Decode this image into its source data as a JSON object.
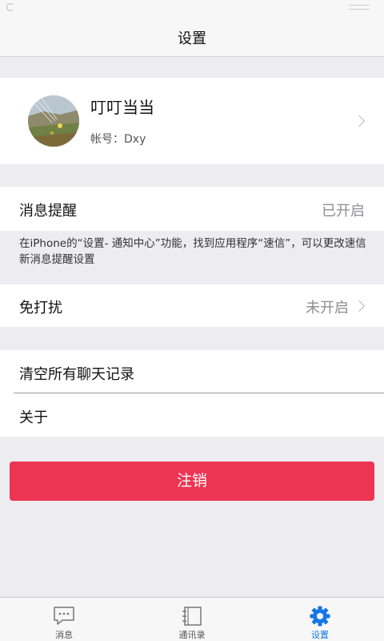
{
  "nav": {
    "title": "设置"
  },
  "profile": {
    "name": "叮叮当当",
    "account_label": "帐号：",
    "account_value": "Dxy"
  },
  "notify": {
    "label": "消息提醒",
    "value": "已开启"
  },
  "hint": {
    "text": "在iPhone的“设置- 通知中心”功能，找到应用程序“速信”，可以更改速信新消息提醒设置"
  },
  "dnd": {
    "label": "免打扰",
    "value": "未开启"
  },
  "misc": {
    "clear_label": "清空所有聊天记录",
    "about_label": "关于"
  },
  "logout": {
    "label": "注销"
  },
  "tabbar": {
    "items": [
      {
        "label": "消息",
        "icon": "chat-icon"
      },
      {
        "label": "通讯录",
        "icon": "contacts-icon"
      },
      {
        "label": "设置",
        "icon": "gear-icon",
        "active": true
      }
    ]
  },
  "colors": {
    "accent": "#1576e6",
    "danger": "#ed3553",
    "background": "#ececf1"
  }
}
